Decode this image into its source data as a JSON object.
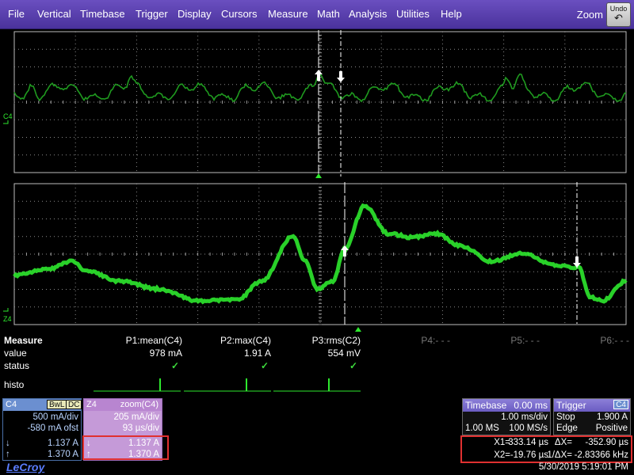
{
  "menu": {
    "items": [
      "File",
      "Vertical",
      "Timebase",
      "Trigger",
      "Display",
      "Cursors",
      "Measure",
      "Math",
      "Analysis",
      "Utilities",
      "Help"
    ],
    "zoom_label": "Zoom",
    "undo_label": "Undo"
  },
  "traces": {
    "top_channel_label": "C4",
    "bottom_channel_label": "Z4",
    "trace_color": "#2ee82e",
    "top_trace_color": "#1f9a1f"
  },
  "measure": {
    "title": "Measure",
    "row_labels": [
      "value",
      "status",
      "histo"
    ],
    "params": [
      {
        "name": "P1:mean(C4)",
        "value": "978 mA",
        "status": "✓"
      },
      {
        "name": "P2:max(C4)",
        "value": "1.91 A",
        "status": "✓"
      },
      {
        "name": "P3:rms(C2)",
        "value": "554 mV",
        "status": "✓"
      },
      {
        "name": "P4:- - -"
      },
      {
        "name": "P5:- - -"
      },
      {
        "name": "P6:- - -"
      }
    ]
  },
  "c4": {
    "label": "C4",
    "tags": [
      "BwL",
      "DC"
    ],
    "scale": "500 mA/div",
    "offset": "-580 mA ofst",
    "cursor_down": "1.137 A",
    "cursor_up": "1.370 A",
    "color": "#6b8fd0"
  },
  "z4": {
    "label": "Z4",
    "source": "zoom(C4)",
    "scale": "205 mA/div",
    "timescale": "93 µs/div",
    "cursor_down": "1.137 A",
    "cursor_up": "1.370 A",
    "color": "#c59ad8"
  },
  "timebase": {
    "title": "Timebase",
    "delay": "0.00 ms",
    "per_div": "1.00 ms/div",
    "samples": "1.00 MS",
    "rate": "100 MS/s"
  },
  "trigger": {
    "title": "Trigger",
    "channel": "C4",
    "mode": "Stop",
    "level": "1.900 A",
    "type": "Edge",
    "slope": "Positive"
  },
  "cursors": {
    "x1_label": "X1=",
    "x1": "333.14 µs",
    "dx_label": "ΔX=",
    "dx": "-352.90 µs",
    "x2_label": "X2=",
    "x2": "-19.76 µs",
    "inv_dx_label": "1/ΔX=",
    "inv_dx": "-2.83366 kHz"
  },
  "brand": "LeCroy",
  "datetime": "5/30/2019 5:19:01 PM"
}
